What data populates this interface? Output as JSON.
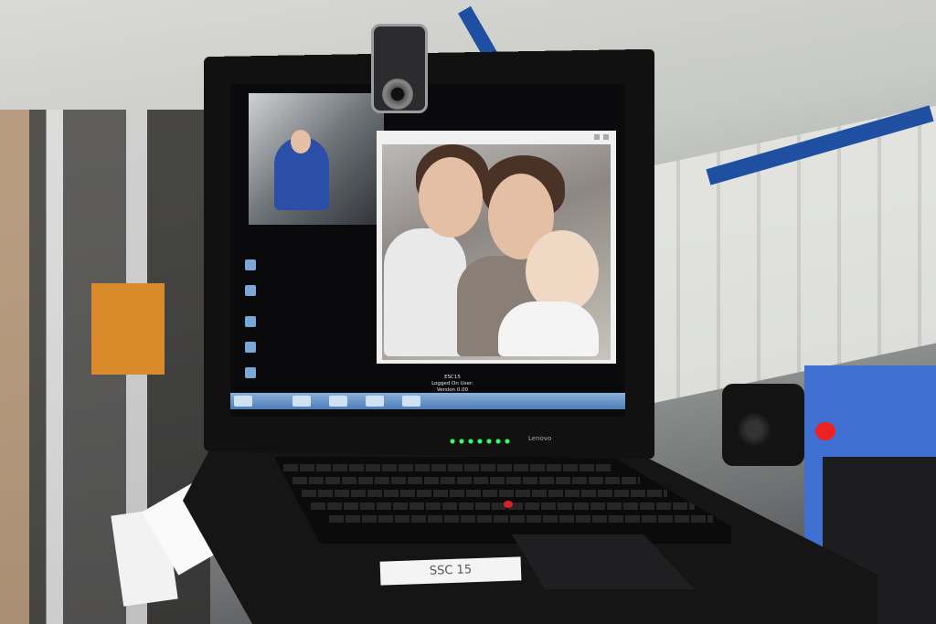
{
  "scene": {
    "description_label": "Laptop video call aboard space station"
  },
  "screen": {
    "logon_line1": "ESC15",
    "logon_line2": "Logged On User:",
    "logon_line3": "Version 0.00"
  },
  "laptop": {
    "brand": "Lenovo",
    "sticker_label": "SSC 15"
  },
  "colors": {
    "blue_beam": "#1f4fa0",
    "trackpoint": "#d4232a",
    "taskbar": "#4f7db8"
  }
}
